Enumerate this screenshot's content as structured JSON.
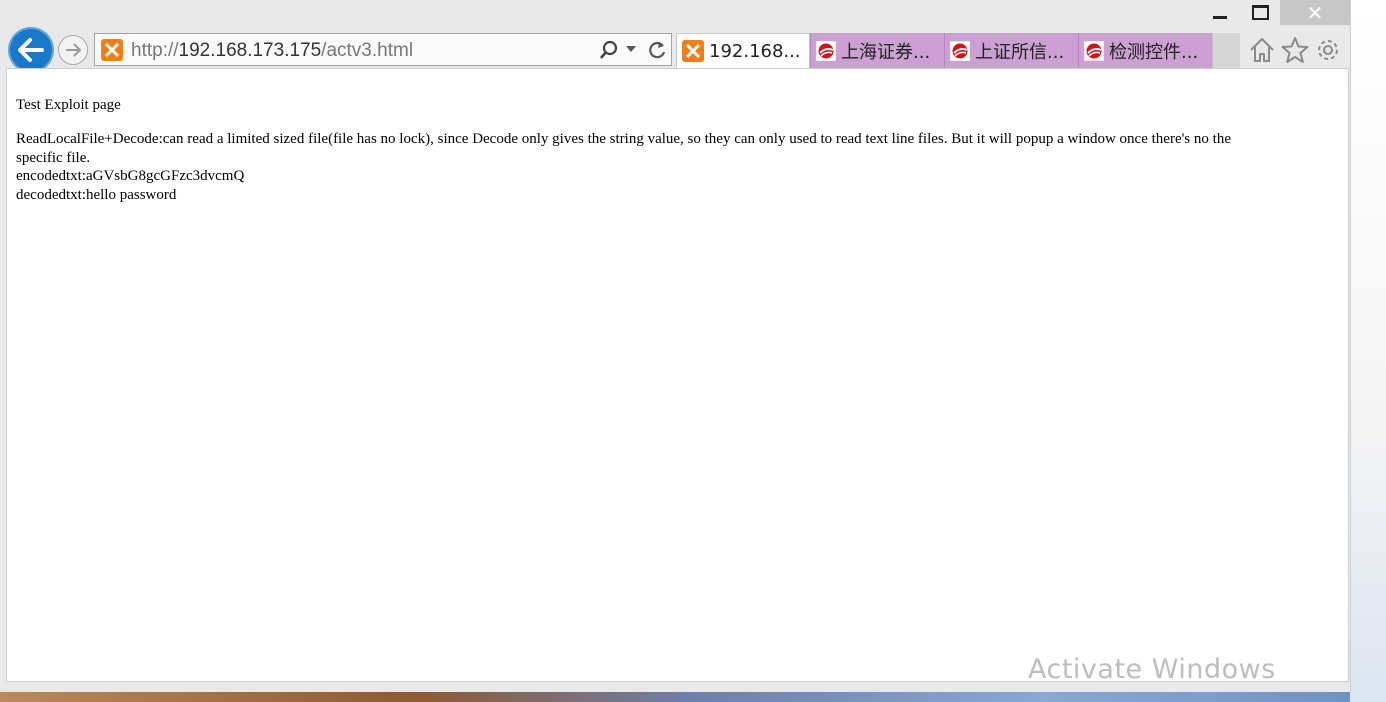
{
  "browser": {
    "url_scheme": "http://",
    "url_host": "192.168.173.175",
    "url_path": "/actv3.html"
  },
  "tabs": [
    {
      "label": "192.168...",
      "active": true,
      "icon": "xampp-icon"
    },
    {
      "label": "上海证券...",
      "active": false,
      "icon": "sse-icon"
    },
    {
      "label": "上证所信...",
      "active": false,
      "icon": "sse-icon"
    },
    {
      "label": "检测控件...",
      "active": false,
      "icon": "sse-icon"
    }
  ],
  "page": {
    "title": "Test Exploit page",
    "desc_line1": "ReadLocalFile+Decode:can read a limited sized file(file has no lock), since Decode only gives the string value, so they can only used to read text line files. But it will popup a window once there's no the",
    "desc_line2": "specific file.",
    "encoded": "encodedtxt:aGVsbG8gcGFzc3dvcmQ",
    "decoded": "decodedtxt:hello password"
  },
  "watermark": "Activate Windows",
  "colors": {
    "back_button": "#1a78c8",
    "tab_inactive": "#cda0d3",
    "xampp": "#f07f1b",
    "sse": "#d0121b"
  }
}
